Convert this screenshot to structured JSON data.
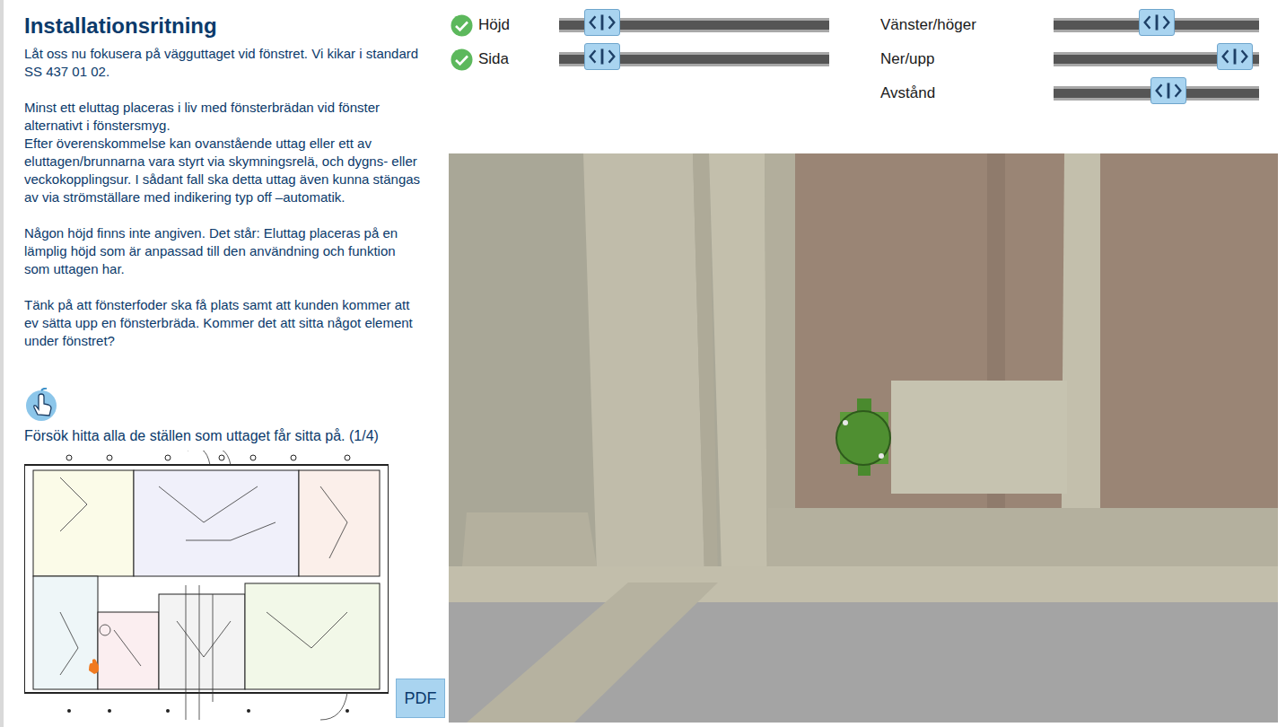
{
  "title": "Installationsritning",
  "paragraphs": [
    [
      "Låt oss nu fokusera på vägguttaget vid fönstret. Vi kikar i standard SS 437 01 02."
    ],
    [
      "Minst ett eluttag placeras i liv med fönsterbrädan vid fönster alternativt i fönstersmyg.",
      "Efter överenskommelse kan ovanstående uttag eller ett av eluttagen/brunnarna vara styrt via skymningsrelä, och dygns- eller veckokopplingsur. I sådant fall ska detta uttag även kunna stängas av via strömställare med indikering typ off –automatik."
    ],
    [
      "Någon höjd finns inte angiven. Det står: Eluttag placeras på en lämplig höjd som är anpassad till den användning och funktion som uttagen har."
    ],
    [
      "Tänk på att fönsterfoder ska få plats samt att kunden kommer att ev sätta upp en fönsterbräda. Kommer det att sitta något element under fönstret?"
    ]
  ],
  "task": "Försök hitta alla de ställen som uttaget får sitta på. (1/4)",
  "pdf_button": "PDF",
  "sliders_left": [
    {
      "label": "Höjd",
      "checked": true,
      "level": 0.16
    },
    {
      "label": "Sida",
      "checked": true,
      "level": 0.16
    }
  ],
  "sliders_right": [
    {
      "label": "Vänster/höger",
      "level": 0.5
    },
    {
      "label": "Ner/upp",
      "level": 0.88
    },
    {
      "label": "Avstånd",
      "level": 0.56
    }
  ]
}
